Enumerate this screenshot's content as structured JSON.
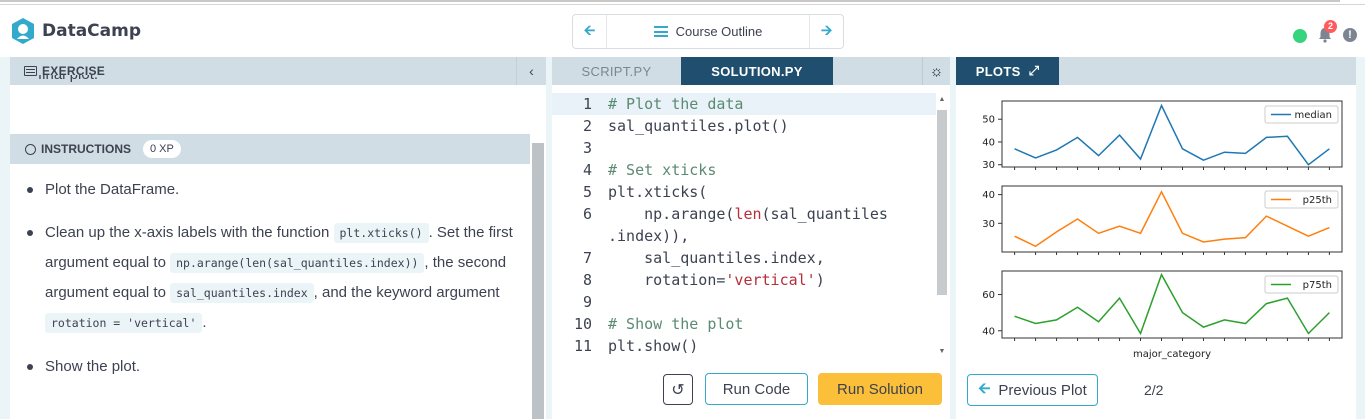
{
  "header": {
    "brand": "DataCamp",
    "course_outline": "Course Outline",
    "notification_count": "2",
    "info_glyph": "!"
  },
  "exercise": {
    "label": "EXERCISE",
    "cut_text": "final plot."
  },
  "instructions": {
    "label": "INSTRUCTIONS",
    "xp": "0 XP",
    "items": [
      {
        "t1": "Plot the DataFrame."
      },
      {
        "t1": "Clean up the x-axis labels with the function ",
        "c1": "plt.xticks()",
        "t2": ". Set the first argument equal to ",
        "c2": "np.arange(len(sal_quantiles.index))",
        "t3": ", the second argument equal to ",
        "c3": "sal_quantiles.index",
        "t4": ", and the keyword argument ",
        "c4": "rotation = 'vertical'",
        "t5": "."
      },
      {
        "t1": "Show the plot."
      }
    ]
  },
  "editor": {
    "tab_script": "SCRIPT.PY",
    "tab_solution": "SOLUTION.PY",
    "lines": [
      {
        "n": "1",
        "segs": [
          {
            "c": "cm",
            "t": "# Plot the data"
          }
        ]
      },
      {
        "n": "2",
        "segs": [
          {
            "c": "",
            "t": "sal_quantiles.plot()"
          }
        ]
      },
      {
        "n": "3",
        "segs": []
      },
      {
        "n": "4",
        "segs": [
          {
            "c": "cm",
            "t": "# Set xticks"
          }
        ]
      },
      {
        "n": "5",
        "segs": [
          {
            "c": "",
            "t": "plt.xticks("
          }
        ]
      },
      {
        "n": "6",
        "segs": [
          {
            "c": "",
            "t": "    np.arange("
          },
          {
            "c": "st",
            "t": "len"
          },
          {
            "c": "",
            "t": "(sal_quantiles"
          }
        ]
      },
      {
        "n": "",
        "segs": [
          {
            "c": "",
            "t": ".index)),"
          }
        ]
      },
      {
        "n": "7",
        "segs": [
          {
            "c": "",
            "t": "    sal_quantiles.index,"
          }
        ]
      },
      {
        "n": "8",
        "segs": [
          {
            "c": "",
            "t": "    rotation="
          },
          {
            "c": "st",
            "t": "'vertical'"
          },
          {
            "c": "",
            "t": ")"
          }
        ]
      },
      {
        "n": "9",
        "segs": []
      },
      {
        "n": "10",
        "segs": [
          {
            "c": "cm",
            "t": "# Show the plot"
          }
        ]
      },
      {
        "n": "11",
        "segs": [
          {
            "c": "",
            "t": "plt.show()"
          }
        ]
      }
    ],
    "run_code": "Run Code",
    "run_solution": "Run Solution"
  },
  "plots": {
    "tab_label": "PLOTS",
    "prev_label": "Previous Plot",
    "pager": "2/2"
  },
  "chart_data": {
    "type": "line",
    "xlabel": "major_category",
    "x": [
      0,
      1,
      2,
      3,
      4,
      5,
      6,
      7,
      8,
      9,
      10,
      11,
      12,
      13,
      14,
      15
    ],
    "subplots": [
      {
        "name": "median",
        "color": "#1f77b4",
        "ylim": [
          29,
          58
        ],
        "yticks": [
          30,
          40,
          50
        ],
        "values": [
          37,
          33,
          36.5,
          42,
          34,
          43,
          32.5,
          56,
          37,
          32,
          35.5,
          35,
          42,
          42.5,
          30,
          37
        ]
      },
      {
        "name": "p25th",
        "color": "#ff7f0e",
        "ylim": [
          20,
          43
        ],
        "yticks": [
          30,
          40
        ],
        "values": [
          25.5,
          22,
          27,
          31.5,
          26.5,
          29,
          26.5,
          41,
          26.5,
          23.5,
          24.5,
          25,
          32.5,
          29,
          25.5,
          28.5
        ]
      },
      {
        "name": "p75th",
        "color": "#2ca02c",
        "ylim": [
          36,
          73
        ],
        "yticks": [
          40,
          60
        ],
        "values": [
          48,
          44,
          46,
          53,
          45,
          58,
          38.5,
          71,
          50,
          42,
          46,
          44,
          55,
          58,
          38.5,
          50
        ]
      }
    ]
  }
}
